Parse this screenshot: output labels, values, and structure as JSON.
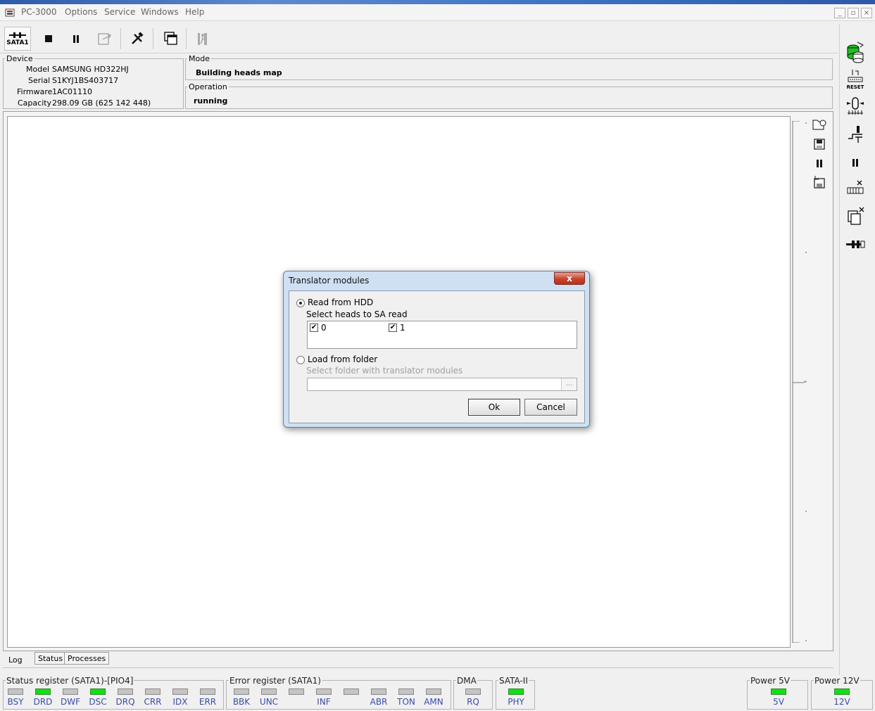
{
  "app": {
    "title": "PC-3000"
  },
  "menu": [
    "Options",
    "Service",
    "Windows",
    "Help"
  ],
  "toolbar": {
    "sata_label": "SATA1"
  },
  "device": {
    "legend": "Device",
    "rows": [
      {
        "label": "Model",
        "value": "SAMSUNG HD322HJ"
      },
      {
        "label": "Serial",
        "value": "S1KYJ1BS403717"
      },
      {
        "label": "Firmware",
        "value": "1AC01110"
      },
      {
        "label": "Capacity",
        "value": "298.09 GB (625 142 448)"
      }
    ]
  },
  "mode": {
    "legend": "Mode",
    "value": "Building heads map"
  },
  "operation": {
    "legend": "Operation",
    "value": "running"
  },
  "tabs": [
    "Log",
    "Status",
    "Processes"
  ],
  "status_register": {
    "label": "Status register (SATA1)-[PIO4]",
    "leds": [
      {
        "name": "BSY",
        "on": false
      },
      {
        "name": "DRD",
        "on": true
      },
      {
        "name": "DWF",
        "on": false
      },
      {
        "name": "DSC",
        "on": true
      },
      {
        "name": "DRQ",
        "on": false
      },
      {
        "name": "CRR",
        "on": false
      },
      {
        "name": "IDX",
        "on": false
      },
      {
        "name": "ERR",
        "on": false
      }
    ]
  },
  "error_register": {
    "label": "Error register (SATA1)",
    "leds": [
      {
        "name": "BBK",
        "on": false
      },
      {
        "name": "UNC",
        "on": false
      },
      {
        "name": "",
        "on": false
      },
      {
        "name": "INF",
        "on": false
      },
      {
        "name": "",
        "on": false
      },
      {
        "name": "ABR",
        "on": false
      },
      {
        "name": "TON",
        "on": false
      },
      {
        "name": "AMN",
        "on": false
      }
    ]
  },
  "dma": {
    "label": "DMA",
    "led": {
      "name": "RQ",
      "on": false
    }
  },
  "sata2": {
    "label": "SATA-II",
    "led": {
      "name": "PHY",
      "on": true
    }
  },
  "power5": {
    "label": "Power 5V",
    "led": {
      "name": "5V",
      "on": true
    }
  },
  "power12": {
    "label": "Power 12V",
    "led": {
      "name": "12V",
      "on": true
    }
  },
  "dialog": {
    "title": "Translator modules",
    "close": "x",
    "read_hdd": "Read from HDD",
    "select_heads": "Select heads to SA read",
    "heads": [
      {
        "label": "0",
        "checked": true
      },
      {
        "label": "1",
        "checked": true
      }
    ],
    "load_folder": "Load from folder",
    "select_folder": "Select folder with translator modules",
    "folder_value": "",
    "browse": "...",
    "ok": "Ok",
    "cancel": "Cancel"
  },
  "colors": {
    "led_on": "#12e012",
    "led_off": "#c4c4c4",
    "label_blue": "#3a4ca8"
  }
}
